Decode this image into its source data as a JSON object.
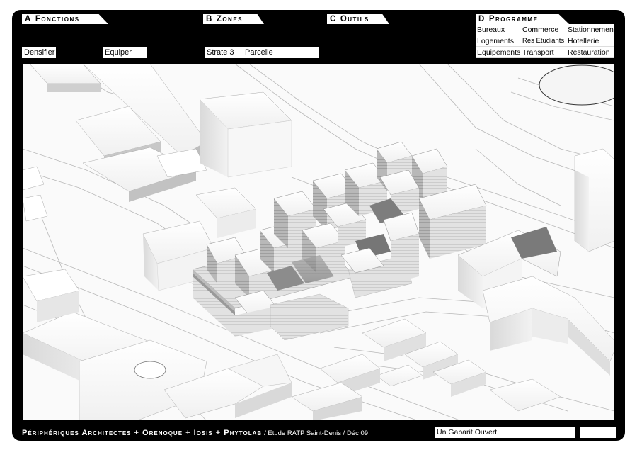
{
  "header": {
    "tabs": [
      {
        "letter": "A",
        "label": "Fonctions"
      },
      {
        "letter": "B",
        "label": "Zones"
      },
      {
        "letter": "C",
        "label": "Outils"
      },
      {
        "letter": "D",
        "label": "Programme"
      }
    ],
    "fields": {
      "densifier": "Densifier",
      "equiper": "Equiper",
      "strate": "Strate 3",
      "parcelle": "Parcelle"
    },
    "programme": [
      "Bureaux",
      "Commerce",
      "Stationnement",
      "Logements",
      "Res Etudiants",
      "Hotellerie",
      "Equipements",
      "Transport",
      "Restauration"
    ]
  },
  "footer": {
    "credits": "Périphériques Architectes + Orenoque + Iosis + Phytolab",
    "study": "/ Etude RATP Saint-Denis / Déc 09",
    "title": "Un Gabarit Ouvert",
    "extra": ""
  },
  "colors": {
    "frame": "#000000",
    "panel": "#ffffff",
    "ground": "#fafafa"
  }
}
